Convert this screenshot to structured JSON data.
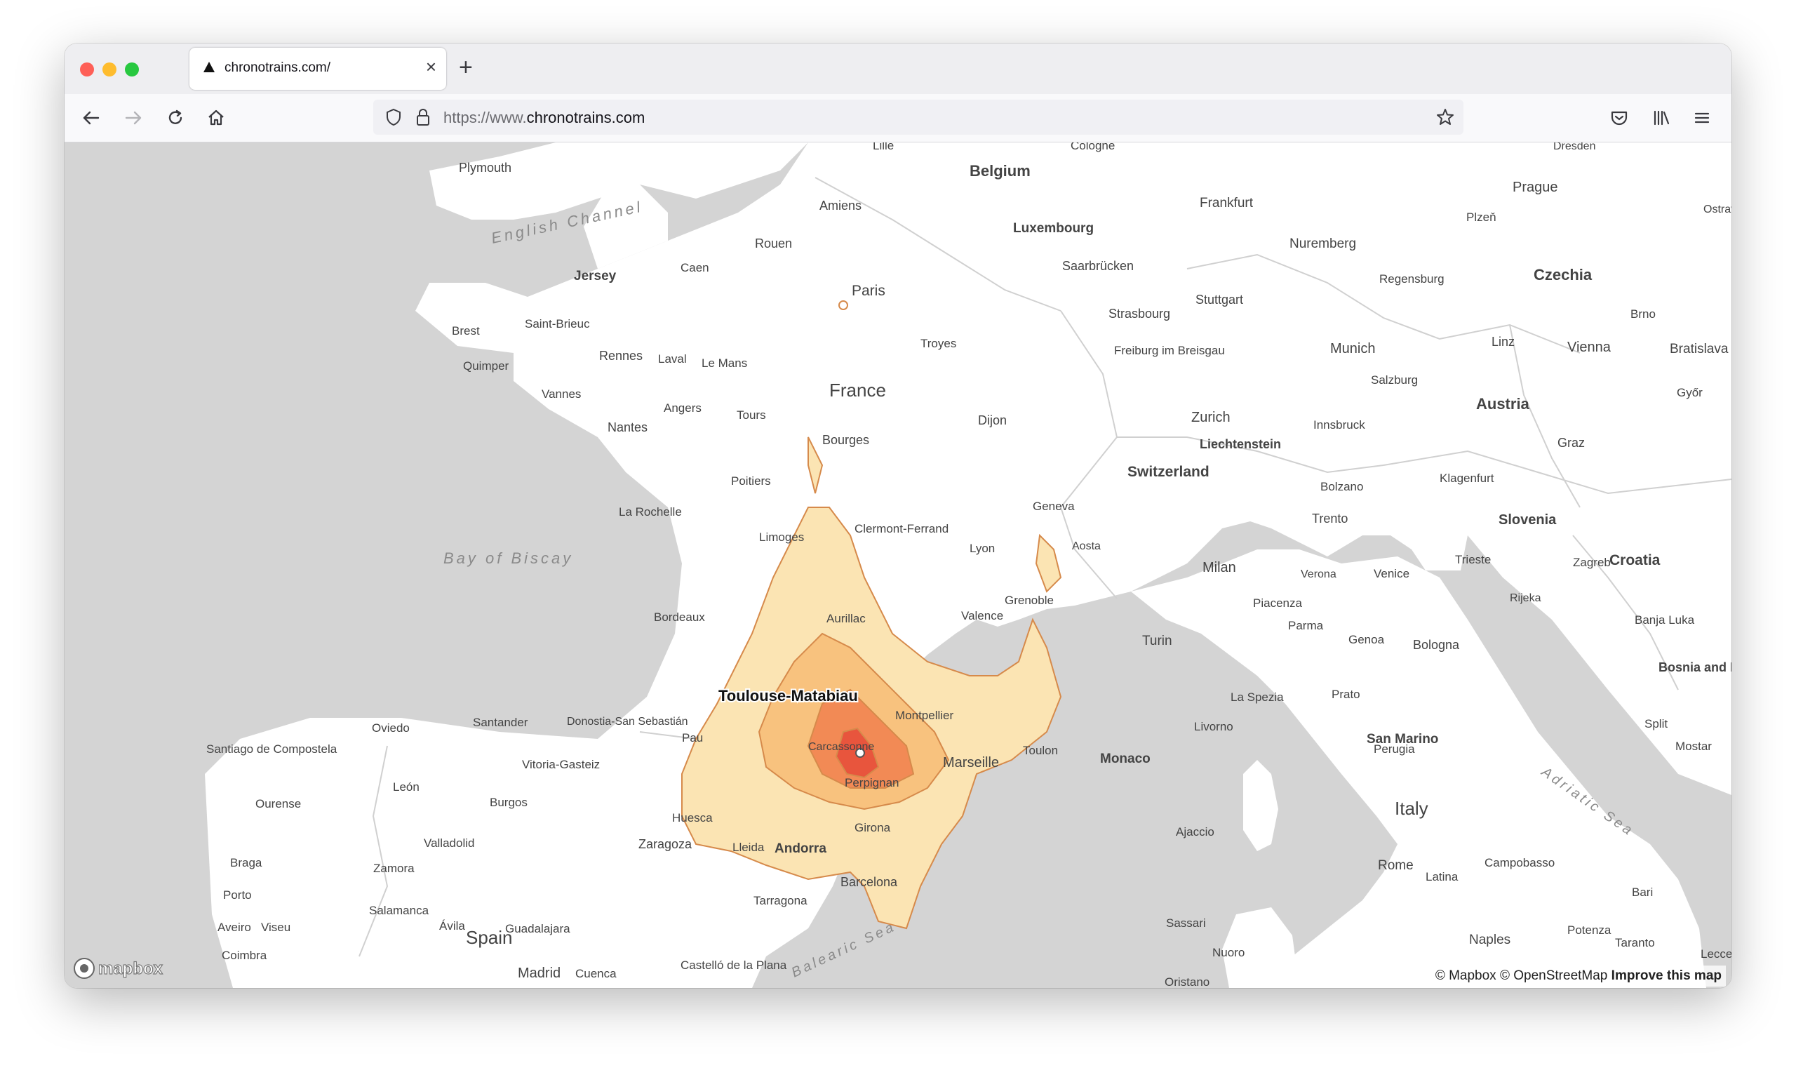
{
  "browser": {
    "tab_title": "chronotrains.com/",
    "close_glyph": "×",
    "newtab_glyph": "+",
    "url_prefix": "https://www.",
    "url_domain": "chronotrains.com",
    "icons": [
      "back-icon",
      "forward-icon",
      "reload-icon",
      "home-icon",
      "shield-icon",
      "lock-icon",
      "bookmark-star-icon",
      "pocket-icon",
      "library-icon",
      "menu-icon"
    ]
  },
  "map": {
    "origin_station": "Toulouse-Matabiau",
    "colors": {
      "sea": "#d4d4d4",
      "land": "#ffffff",
      "border": "#cfcfcf",
      "isochrone_outer": "#fbe4b3",
      "isochrone_mid": "#f8c27e",
      "isochrone_inner": "#f28a55",
      "isochrone_core": "#e8553d",
      "outline": "#d68a4b"
    },
    "countries": [
      "Belgium",
      "Luxembourg",
      "France",
      "Switzerland",
      "Liechtenstein",
      "Austria",
      "Czechia",
      "Slovenia",
      "Croatia",
      "Bosnia and Herzegovina",
      "Italy",
      "Spain",
      "Andorra",
      "Monaco",
      "San Marino"
    ],
    "seas": [
      "English Channel",
      "Bay of Biscay",
      "Adriatic Sea",
      "Balearic Sea"
    ],
    "cities": [
      "Plymouth",
      "Jersey",
      "Amiens",
      "Rouen",
      "Caen",
      "Paris",
      "Frankfurt",
      "Prague",
      "Plzeň",
      "Nuremberg",
      "Saarbrücken",
      "Regensburg",
      "Stuttgart",
      "Strasbourg",
      "Freiburg im Breisgau",
      "Troyes",
      "Brest",
      "Saint-Brieuc",
      "Rennes",
      "Laval",
      "Le Mans",
      "Quimper",
      "Vannes",
      "Angers",
      "Tours",
      "Nantes",
      "Bourges",
      "Dijon",
      "Munich",
      "Linz",
      "Vienna",
      "Bratislava",
      "Salzburg",
      "Zurich",
      "Innsbruck",
      "Graz",
      "Győr",
      "Poitiers",
      "La Rochelle",
      "Limoges",
      "Clermont-Ferrand",
      "Geneva",
      "Bolzano",
      "Klagenfurt",
      "Trento",
      "Lyon",
      "Aosta",
      "Milan",
      "Verona",
      "Venice",
      "Trieste",
      "Zagreb",
      "Rijeka",
      "Bordeaux",
      "Aurillac",
      "Grenoble",
      "Valence",
      "Turin",
      "Piacenza",
      "Parma",
      "Genoa",
      "Bologna",
      "Banja Luka",
      "Oviedo",
      "Santander",
      "Donostia-San Sebastián",
      "Pau",
      "Montpellier",
      "Carcassonne",
      "Marseille",
      "Toulon",
      "Livorno",
      "La Spezia",
      "Prato",
      "Perugia",
      "Split",
      "Mostar",
      "Santiago de Compostela",
      "Vitoria-Gasteiz",
      "León",
      "Burgos",
      "Ourense",
      "Huesca",
      "Perpignan",
      "Girona",
      "Ajaccio",
      "Zaragoza",
      "Lleida",
      "Valladolid",
      "Braga",
      "Zamora",
      "Porto",
      "Salamanca",
      "Barcelona",
      "Tarragona",
      "Rome",
      "Latina",
      "Campobasso",
      "Bari",
      "Aveiro",
      "Viseu",
      "Ávila",
      "Guadalajara",
      "Madrid",
      "Cuenca",
      "Castelló de la Plana",
      "Sassari",
      "Nuoro",
      "Naples",
      "Potenza",
      "Taranto",
      "Coimbra",
      "Oristano",
      "Lecce",
      "Ostrava",
      "Brno",
      "Dresden",
      "Cologne",
      "Lille"
    ],
    "attribution": {
      "mapbox": "© Mapbox",
      "osm": "© OpenStreetMap",
      "improve": "Improve this map"
    },
    "logo_text": "mapbox"
  }
}
